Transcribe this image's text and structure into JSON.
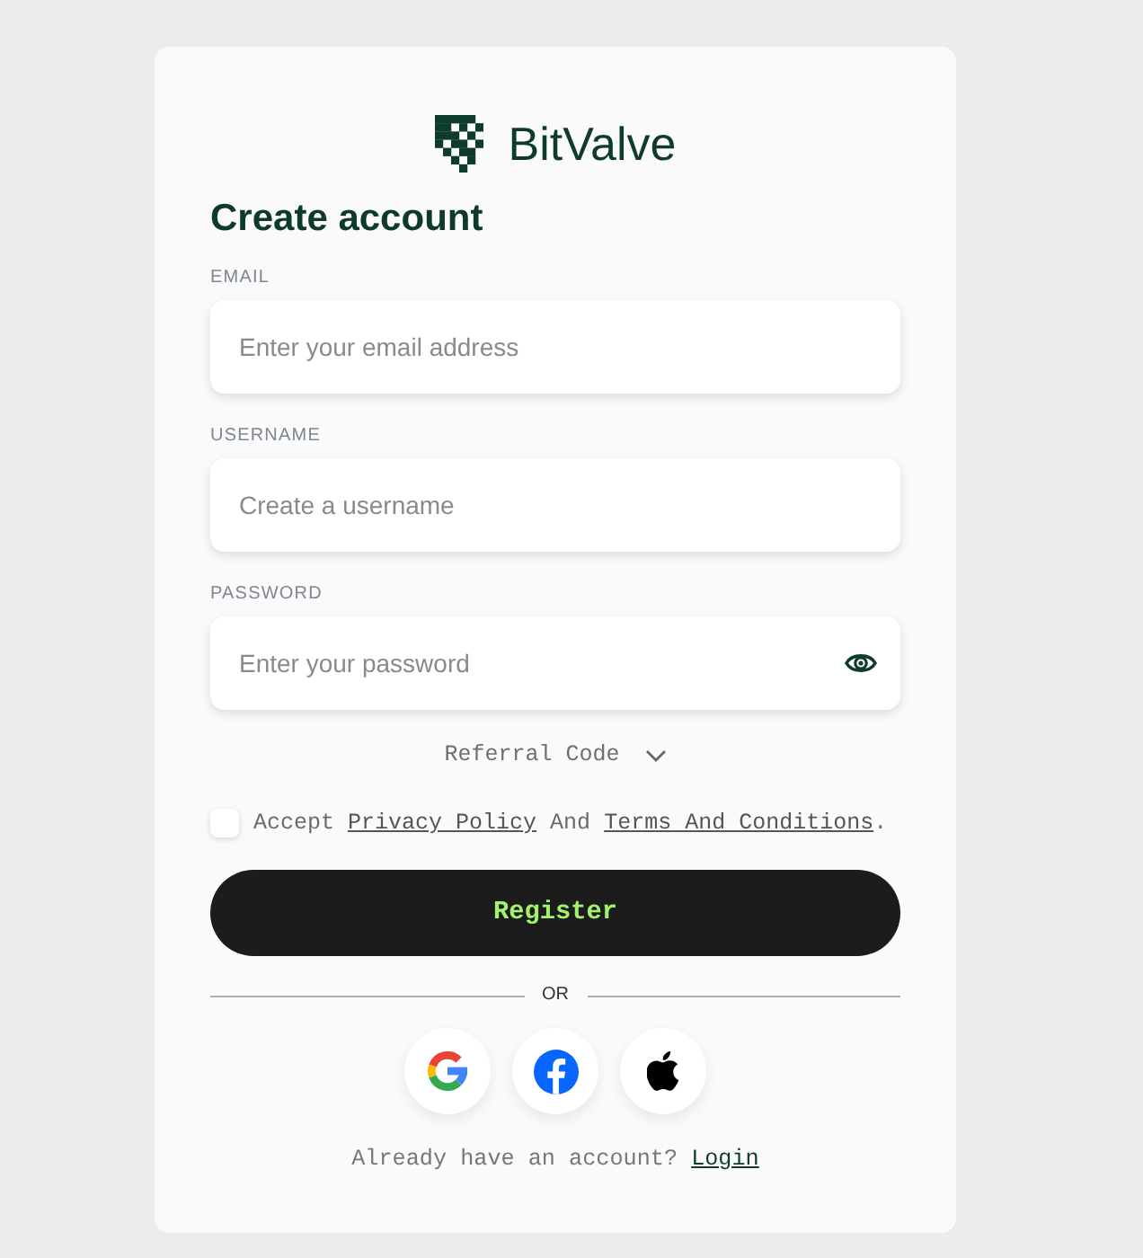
{
  "logo": {
    "text": "BitValve"
  },
  "heading": "Create account",
  "fields": [
    {
      "kind": "email",
      "label": "EMAIL",
      "placeholder": "Enter your email address"
    },
    {
      "kind": "text",
      "label": "USERNAME",
      "placeholder": "Create a username"
    },
    {
      "kind": "password",
      "label": "PASSWORD",
      "placeholder": "Enter your password"
    }
  ],
  "referral": {
    "label": "Referral Code",
    "expanded": false
  },
  "terms": {
    "checked": false,
    "segments": [
      {
        "kind": "text",
        "text": "Accept "
      },
      {
        "kind": "link",
        "text": "Privacy Policy"
      },
      {
        "kind": "text",
        "text": " And "
      },
      {
        "kind": "link",
        "text": "Terms And Conditions"
      },
      {
        "kind": "text",
        "text": "."
      }
    ]
  },
  "register_button": "Register",
  "divider": "OR",
  "footer": {
    "text": "Already have an account? ",
    "link": "Login"
  }
}
